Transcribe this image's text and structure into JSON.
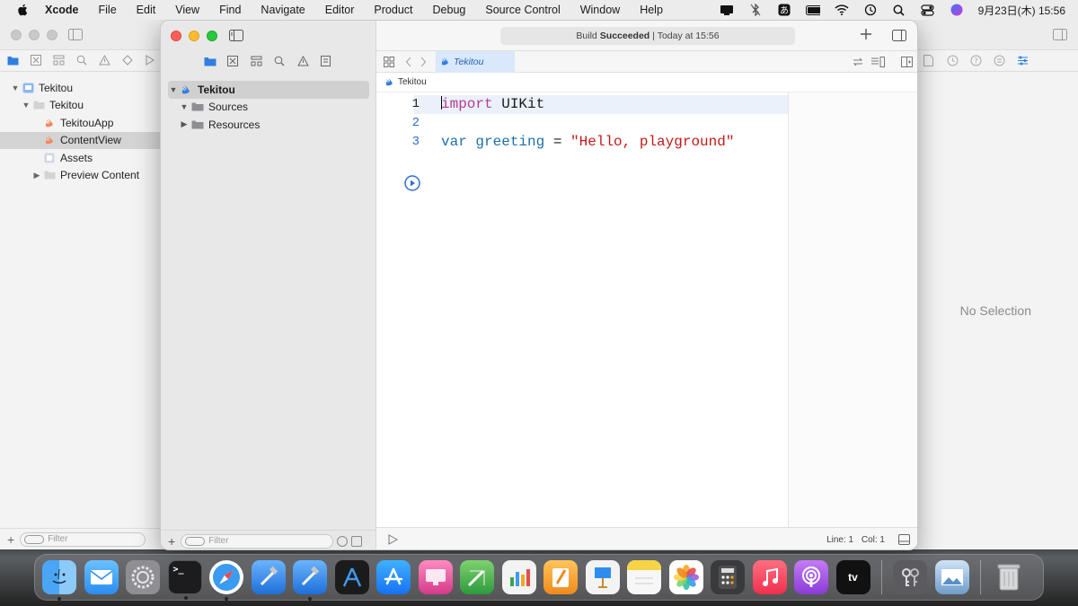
{
  "menubar": {
    "app_name": "Xcode",
    "menus": [
      "File",
      "Edit",
      "View",
      "Find",
      "Navigate",
      "Editor",
      "Product",
      "Debug",
      "Source Control",
      "Window",
      "Help"
    ],
    "clock": "9月23日(木)  15:56"
  },
  "back_window": {
    "navigator": {
      "items": [
        {
          "label": "Tekitou",
          "icon": "playground-icon",
          "level": 0,
          "disclosure": "open"
        },
        {
          "label": "Tekitou",
          "icon": "folder-icon",
          "level": 1,
          "disclosure": "open"
        },
        {
          "label": "TekitouApp",
          "icon": "swift-file-icon",
          "level": 2,
          "disclosure": "none"
        },
        {
          "label": "ContentView",
          "icon": "swift-file-icon",
          "level": 2,
          "disclosure": "none",
          "selected": true
        },
        {
          "label": "Assets",
          "icon": "asset-catalog-icon",
          "level": 2,
          "disclosure": "none"
        },
        {
          "label": "Preview Content",
          "icon": "folder-icon",
          "level": 2,
          "disclosure": "closed"
        }
      ],
      "filter_placeholder": "Filter"
    },
    "inspector": {
      "empty_text": "No Selection"
    }
  },
  "front_window": {
    "navigator": {
      "items": [
        {
          "label": "Tekitou",
          "icon": "playground-icon",
          "level": 0,
          "disclosure": "open",
          "selected": true
        },
        {
          "label": "Sources",
          "icon": "folder-icon",
          "level": 1,
          "disclosure": "open"
        },
        {
          "label": "Resources",
          "icon": "folder-icon",
          "level": 1,
          "disclosure": "closed"
        }
      ],
      "filter_placeholder": "Filter"
    },
    "toolbar": {
      "status_prefix": "Build",
      "status_strong": "Succeeded",
      "status_suffix": "| Today at 15:56"
    },
    "tab": {
      "label": "Tekitou"
    },
    "jumpbar": {
      "label": "Tekitou"
    },
    "editor": {
      "line_numbers": [
        "1",
        "2",
        "3"
      ],
      "line1": {
        "kw": "import",
        "rest": " UIKit"
      },
      "line3": {
        "kw": "var",
        "ident": " greeting ",
        "op": "= ",
        "str": "\"Hello, playground\""
      }
    },
    "bottom_bar": {
      "line": "Line: 1",
      "col": "Col: 1"
    }
  },
  "dock": {
    "apps": [
      {
        "name": "Finder",
        "icon": "finder-icon",
        "color": "#3b8ee8",
        "running": true
      },
      {
        "name": "Mail",
        "icon": "mail-icon",
        "color": "#5aa8f0",
        "running": false
      },
      {
        "name": "System Preferences",
        "icon": "gear-icon",
        "color": "#8e8e93",
        "running": false
      },
      {
        "name": "Terminal",
        "icon": "terminal-icon",
        "color": "#222222",
        "running": true
      },
      {
        "name": "Safari",
        "icon": "safari-icon",
        "color": "#3c9bf0",
        "running": true
      },
      {
        "name": "Xcode",
        "icon": "xcode-icon",
        "color": "#2b7ad8",
        "running": false
      },
      {
        "name": "Xcode",
        "icon": "xcode-icon",
        "color": "#2f8df0",
        "running": true
      },
      {
        "name": "Instruments",
        "icon": "instruments-icon",
        "color": "#1b1b1b",
        "running": false
      },
      {
        "name": "App Store",
        "icon": "appstore-icon",
        "color": "#1e8bf5",
        "running": false
      },
      {
        "name": "Reality Composer",
        "icon": "display-icon",
        "color": "#e9589a",
        "running": false
      },
      {
        "name": "Numbers",
        "icon": "numbers-icon",
        "color": "#3ba54a",
        "running": false
      },
      {
        "name": "Numbers",
        "icon": "chart-icon",
        "color": "#f3f3f3",
        "running": false
      },
      {
        "name": "Pages",
        "icon": "pages-icon",
        "color": "#f4a623",
        "running": false
      },
      {
        "name": "Keynote",
        "icon": "keynote-icon",
        "color": "#2f8df0",
        "running": false
      },
      {
        "name": "Notes",
        "icon": "notes-icon",
        "color": "#f7d347",
        "running": false
      },
      {
        "name": "Photos",
        "icon": "photos-icon",
        "color": "#f2f2f2",
        "running": false
      },
      {
        "name": "Calculator",
        "icon": "calculator-icon",
        "color": "#3a3a3c",
        "running": false
      },
      {
        "name": "Music",
        "icon": "music-icon",
        "color": "#f53b57",
        "running": false
      },
      {
        "name": "Podcasts",
        "icon": "podcasts-icon",
        "color": "#9b4fe0",
        "running": false
      },
      {
        "name": "TV",
        "icon": "tv-icon",
        "color": "#111111",
        "running": false
      },
      {
        "name": "Keychain Access",
        "icon": "keychain-icon",
        "color": "#5b5b5f",
        "running": false
      },
      {
        "name": "Preview",
        "icon": "preview-icon",
        "color": "#8fb8e0",
        "running": false
      },
      {
        "name": "Trash",
        "icon": "trash-icon",
        "color": "#c8c8cc",
        "running": false
      }
    ],
    "tv_label": "tv"
  },
  "colors": {
    "accent": "#2f6fd0",
    "keyword": "#b83a8e",
    "string": "#c41a16",
    "traffic_red": "#ff5f57",
    "traffic_yellow": "#febc2e",
    "traffic_green": "#28c840"
  }
}
